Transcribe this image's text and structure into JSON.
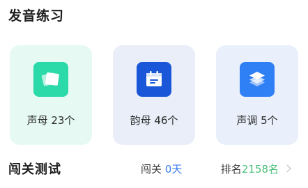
{
  "header": {
    "title": "发音练习"
  },
  "cards": [
    {
      "label": "声母 23个",
      "bg_color": "#e6faf3",
      "icon_color": "#2cd9a8",
      "icon": "cards-stack-icon"
    },
    {
      "label": "韵母 46个",
      "bg_color": "#e9eef9",
      "icon_color": "#1a57d8",
      "icon": "calendar-icon"
    },
    {
      "label": "声调 5个",
      "bg_color": "#e9f0fb",
      "icon_color": "#2f7ff5",
      "icon": "layers-icon"
    }
  ],
  "footer": {
    "title": "闯关测试",
    "pass_label": "闯关 ",
    "pass_value": "0天",
    "rank_label": "排名 ",
    "rank_value": "2158名"
  }
}
